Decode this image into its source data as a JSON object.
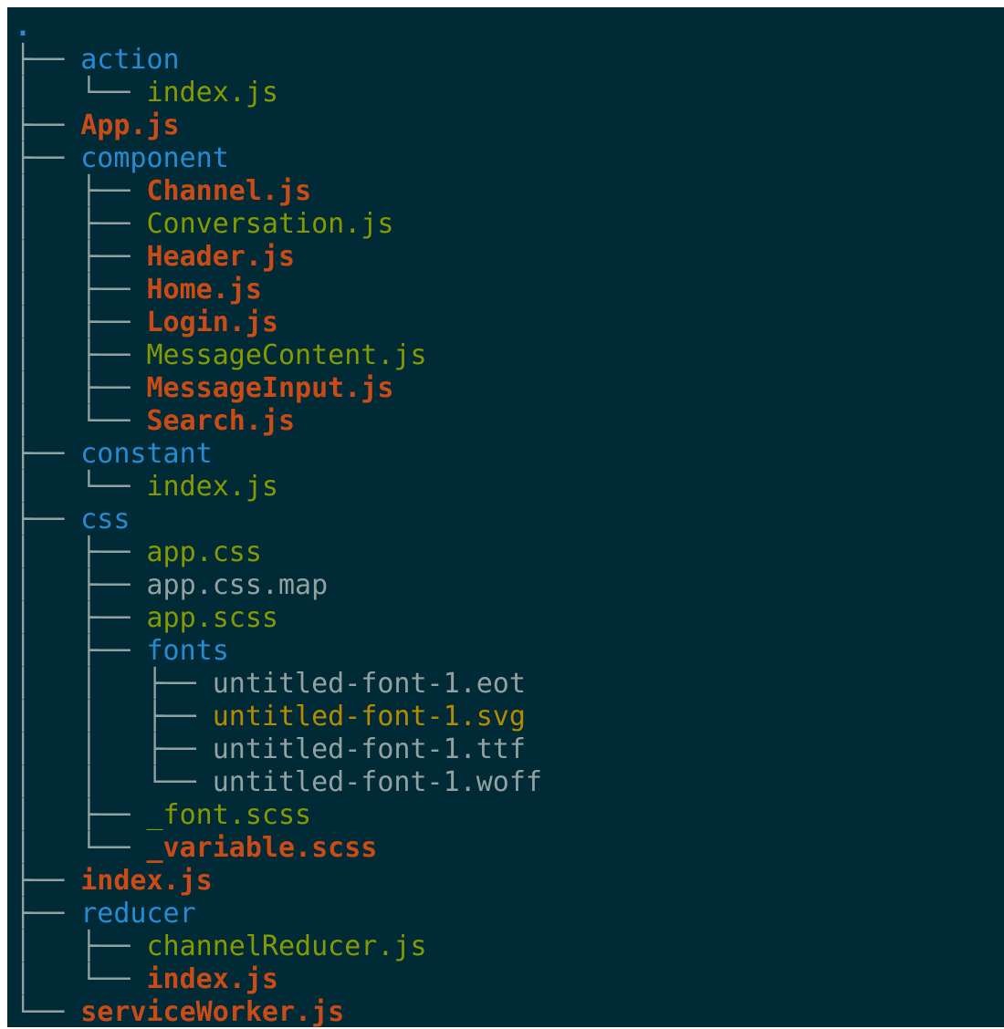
{
  "tree": {
    "root": ".",
    "lines": [
      {
        "prefix": "├── ",
        "name": "action",
        "kind": "dir"
      },
      {
        "prefix": "│   └── ",
        "name": "index.js",
        "kind": "green"
      },
      {
        "prefix": "├── ",
        "name": "App.js",
        "kind": "js"
      },
      {
        "prefix": "├── ",
        "name": "component",
        "kind": "dir"
      },
      {
        "prefix": "│   ├── ",
        "name": "Channel.js",
        "kind": "js"
      },
      {
        "prefix": "│   ├── ",
        "name": "Conversation.js",
        "kind": "green"
      },
      {
        "prefix": "│   ├── ",
        "name": "Header.js",
        "kind": "js"
      },
      {
        "prefix": "│   ├── ",
        "name": "Home.js",
        "kind": "js"
      },
      {
        "prefix": "│   ├── ",
        "name": "Login.js",
        "kind": "js"
      },
      {
        "prefix": "│   ├── ",
        "name": "MessageContent.js",
        "kind": "green"
      },
      {
        "prefix": "│   ├── ",
        "name": "MessageInput.js",
        "kind": "js"
      },
      {
        "prefix": "│   └── ",
        "name": "Search.js",
        "kind": "js"
      },
      {
        "prefix": "├── ",
        "name": "constant",
        "kind": "dir"
      },
      {
        "prefix": "│   └── ",
        "name": "index.js",
        "kind": "green"
      },
      {
        "prefix": "├── ",
        "name": "css",
        "kind": "dir"
      },
      {
        "prefix": "│   ├── ",
        "name": "app.css",
        "kind": "green"
      },
      {
        "prefix": "│   ├── ",
        "name": "app.css.map",
        "kind": "gray"
      },
      {
        "prefix": "│   ├── ",
        "name": "app.scss",
        "kind": "green"
      },
      {
        "prefix": "│   ├── ",
        "name": "fonts",
        "kind": "dir"
      },
      {
        "prefix": "│   │   ├── ",
        "name": "untitled-font-1.eot",
        "kind": "gray"
      },
      {
        "prefix": "│   │   ├── ",
        "name": "untitled-font-1.svg",
        "kind": "yellow"
      },
      {
        "prefix": "│   │   ├── ",
        "name": "untitled-font-1.ttf",
        "kind": "gray"
      },
      {
        "prefix": "│   │   └── ",
        "name": "untitled-font-1.woff",
        "kind": "gray"
      },
      {
        "prefix": "│   ├── ",
        "name": "_font.scss",
        "kind": "green"
      },
      {
        "prefix": "│   └── ",
        "name": "_variable.scss",
        "kind": "js"
      },
      {
        "prefix": "├── ",
        "name": "index.js",
        "kind": "js"
      },
      {
        "prefix": "├── ",
        "name": "reducer",
        "kind": "dir"
      },
      {
        "prefix": "│   ├── ",
        "name": "channelReducer.js",
        "kind": "green"
      },
      {
        "prefix": "│   └── ",
        "name": "index.js",
        "kind": "js"
      },
      {
        "prefix": "└── ",
        "name": "serviceWorker.js",
        "kind": "js"
      }
    ]
  },
  "colors": {
    "background": "#002b36",
    "directory": "#268bd2",
    "bold_file": "#cb4b16",
    "green_file": "#859900",
    "plain_file": "#93a1a1",
    "yellow_file": "#b58900"
  }
}
